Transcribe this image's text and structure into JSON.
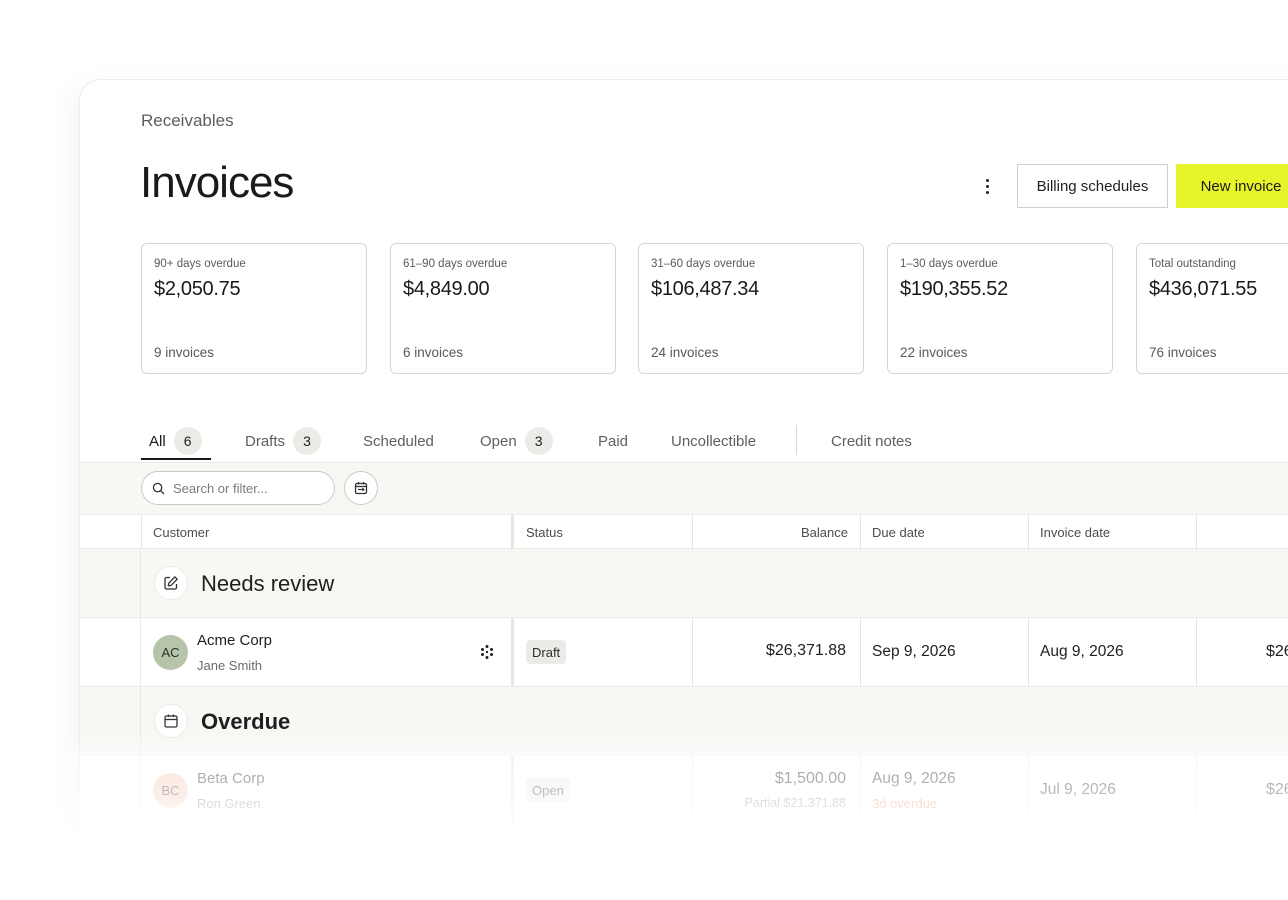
{
  "breadcrumb": "Receivables",
  "page_title": "Invoices",
  "header": {
    "billing_schedules_label": "Billing schedules",
    "new_invoice_label": "New invoice",
    "accent_color": "#e6f52a"
  },
  "summary_cards": [
    {
      "label": "90+ days overdue",
      "value": "$2,050.75",
      "count": "9 invoices"
    },
    {
      "label": "61–90 days overdue",
      "value": "$4,849.00",
      "count": "6 invoices"
    },
    {
      "label": "31–60 days overdue",
      "value": "$106,487.34",
      "count": "24 invoices"
    },
    {
      "label": "1–30 days overdue",
      "value": "$190,355.52",
      "count": "22 invoices"
    },
    {
      "label": "Total outstanding",
      "value": "$436,071.55",
      "count": "76 invoices"
    }
  ],
  "tabs": [
    {
      "label": "All",
      "count": "6",
      "active": true
    },
    {
      "label": "Drafts",
      "count": "3"
    },
    {
      "label": "Scheduled"
    },
    {
      "label": "Open",
      "count": "3"
    },
    {
      "label": "Paid"
    },
    {
      "label": "Uncollectible"
    },
    {
      "label": "Credit notes"
    }
  ],
  "search": {
    "placeholder": "Search or filter..."
  },
  "table": {
    "columns": {
      "customer": "Customer",
      "status": "Status",
      "balance": "Balance",
      "due_date": "Due date",
      "invoice_date": "Invoice date"
    },
    "groups": [
      {
        "title": "Needs review",
        "icon": "edit-icon",
        "rows": [
          {
            "initials": "AC",
            "avatar_color": "#b6c4aa",
            "customer": "Acme Corp",
            "contact": "Jane Smith",
            "status": "Draft",
            "balance": "$26,371.88",
            "due_date": "Sep 9, 2026",
            "invoice_date": "Aug 9, 2026",
            "amount": "$26"
          }
        ]
      },
      {
        "title": "Overdue",
        "icon": "calendar-icon",
        "rows": [
          {
            "initials": "BC",
            "avatar_color": "#f3c6b3",
            "customer": "Beta Corp",
            "contact": "Ron Green",
            "status": "Open",
            "balance": "$1,500.00",
            "balance_note": "Partial $21,371.88",
            "due_date": "Aug 9, 2026",
            "due_note": "3d overdue",
            "invoice_date": "Jul 9, 2026",
            "amount": "$26"
          }
        ]
      }
    ]
  }
}
